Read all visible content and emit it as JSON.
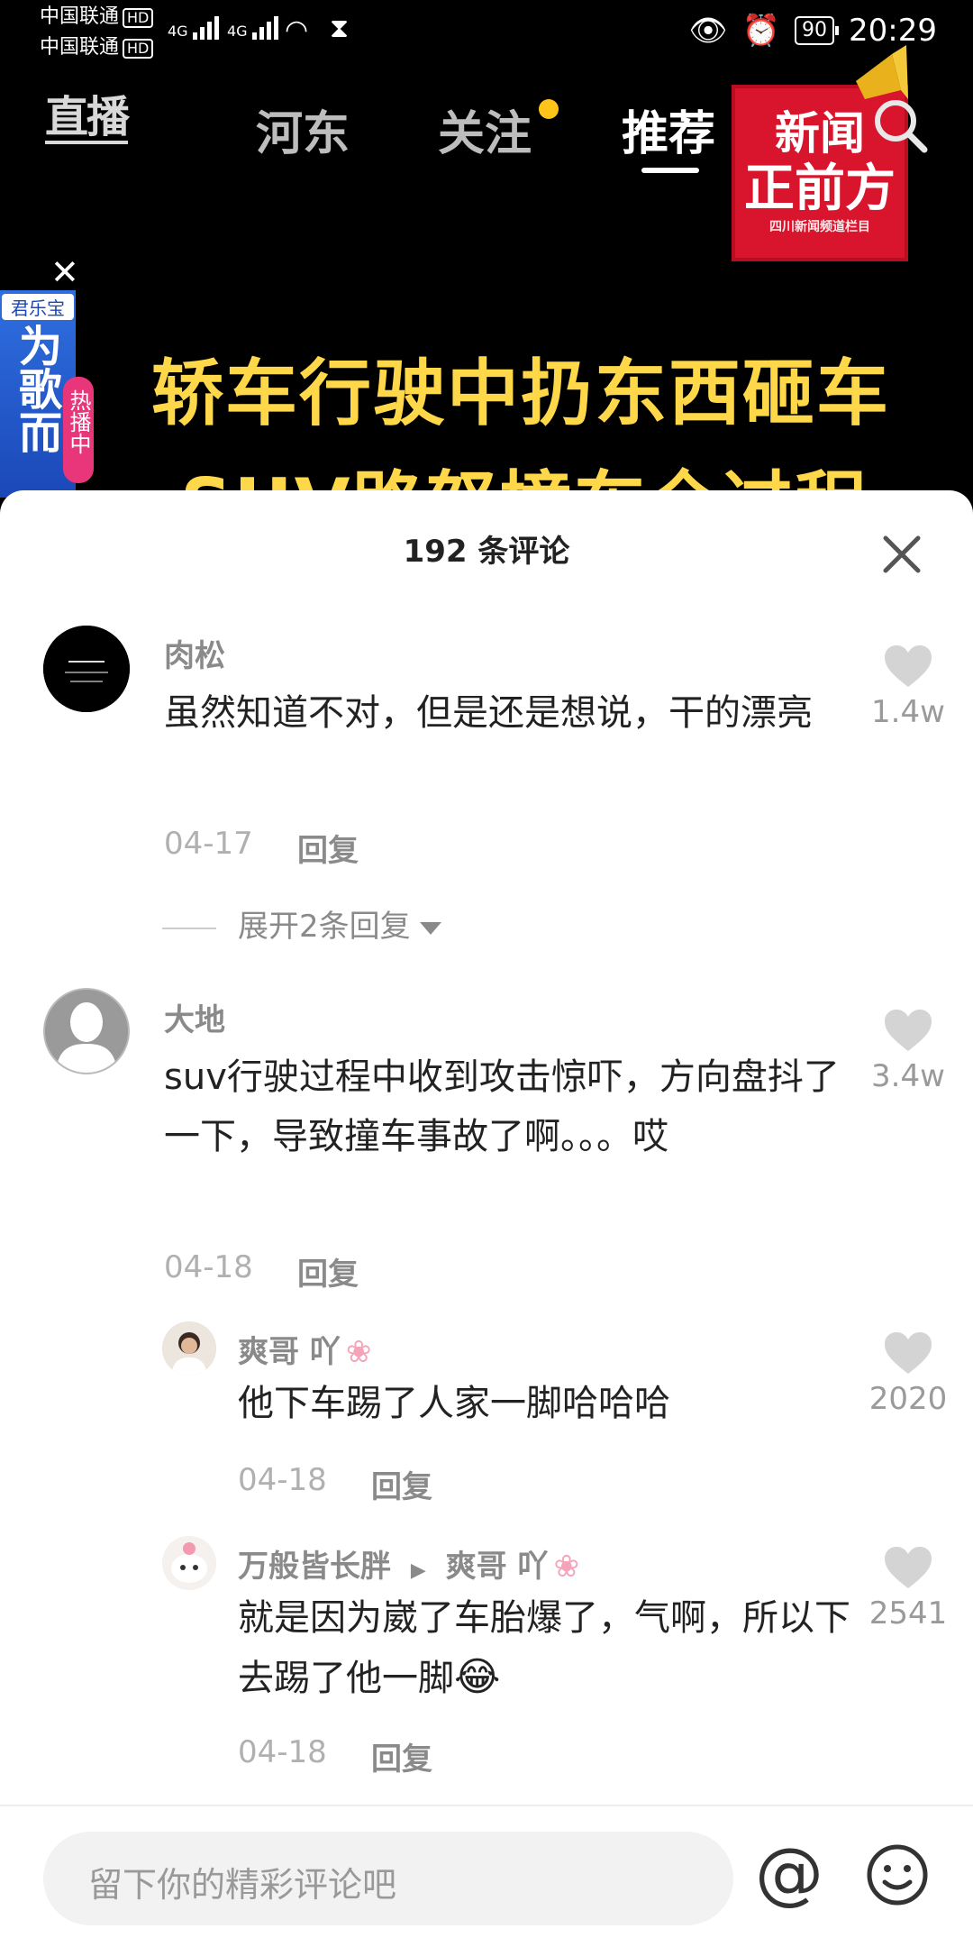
{
  "status": {
    "carrier1": "中国联通",
    "carrier2": "中国联通",
    "hd": "HD",
    "net": "4G",
    "battery": "90",
    "time": "20:29"
  },
  "nav": {
    "live": "直播",
    "tabs": [
      {
        "label": "河东"
      },
      {
        "label": "关注"
      },
      {
        "label": "推荐"
      }
    ],
    "logo": {
      "line1": "新闻",
      "line2": "正前方",
      "line3": "四川新闻频道栏目"
    }
  },
  "video": {
    "title_line1": "轿车行驶中扔东西砸车",
    "title_line2": "SUV路怒撞车全过程",
    "ad_brand": "君乐宝",
    "ad_text": "为歌而",
    "hot_badge": "热播中"
  },
  "comments_sheet": {
    "title": "192 条评论",
    "expand_replies": "展开2条回复",
    "comments": [
      {
        "user": "肉松",
        "text": "虽然知道不对，但是还是想说，干的漂亮",
        "date": "04-17",
        "reply": "回复",
        "likes": "1.4w"
      },
      {
        "user": "大地",
        "text": "suv行驶过程中收到攻击惊吓，方向盘抖了一下，导致撞车事故了啊。。。哎",
        "date": "04-18",
        "reply": "回复",
        "likes": "3.4w"
      }
    ],
    "replies": [
      {
        "user": "爽哥 吖",
        "text": "他下车踢了人家一脚哈哈哈",
        "date": "04-18",
        "reply": "回复",
        "likes": "2020"
      },
      {
        "user": "万般皆长胖",
        "reply_to": "爽哥 吖",
        "text": "就是因为崴了车胎爆了，气啊，所以下去踢了他一脚",
        "date": "04-18",
        "reply": "回复",
        "likes": "2541"
      }
    ]
  },
  "input": {
    "placeholder": "留下你的精彩评论吧",
    "at": "@"
  }
}
